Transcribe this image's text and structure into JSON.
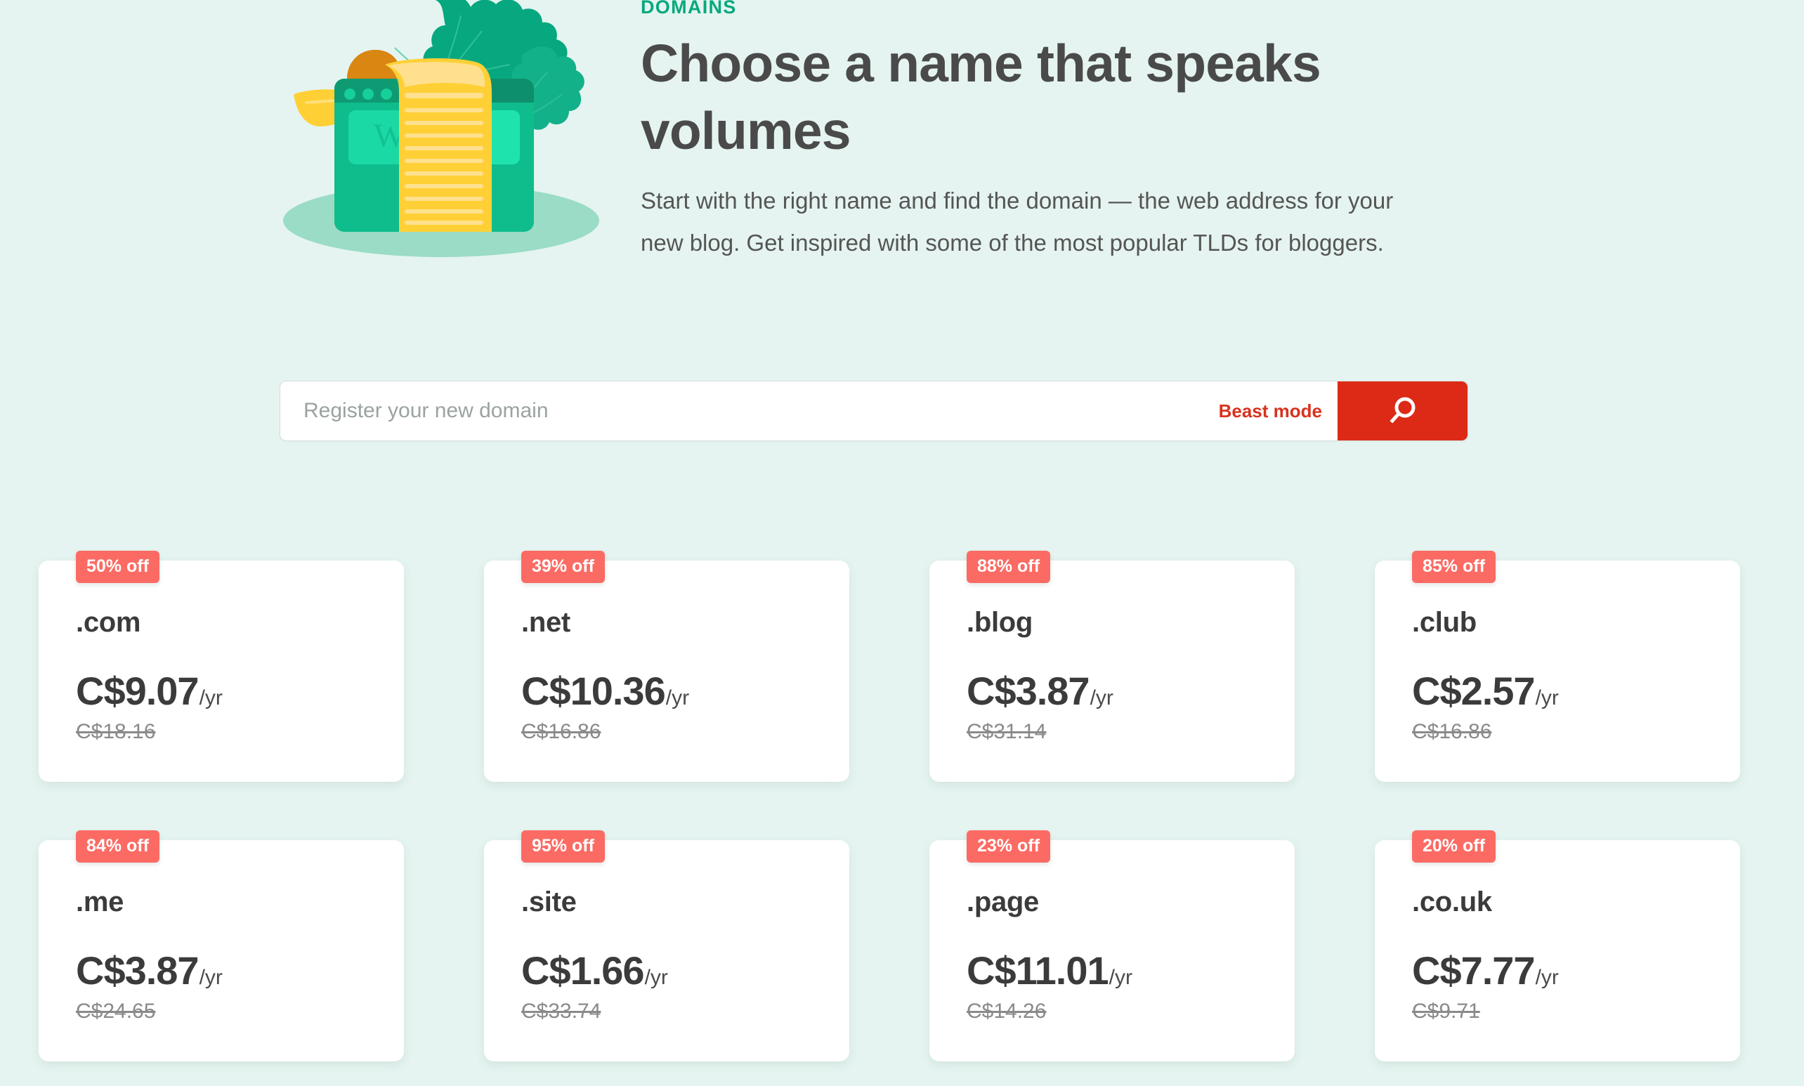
{
  "hero": {
    "eyebrow": "DOMAINS",
    "title": "Choose a name that speaks volumes",
    "description": "Start with the right name and find the domain — the web address for your new blog. Get inspired with some of the most popular TLDs for bloggers.",
    "illustration_name": "blog-window-scroll-leaf-illustration",
    "illustration_logo_letter": "W"
  },
  "search": {
    "placeholder": "Register your new domain",
    "value": "",
    "beast_mode_label": "Beast mode",
    "submit_icon": "search-icon",
    "button_color": "#DC2A16",
    "beast_mode_color": "#D8321E"
  },
  "colors": {
    "background": "#E5F4F0",
    "eyebrow": "#07A87F",
    "badge": "#FB6B64",
    "heading": "#4A4A4A",
    "card": "#FFFFFF",
    "old_price": "#8A8A8A"
  },
  "cards": [
    {
      "tld": ".com",
      "badge": "50% off",
      "price": "C$9.07",
      "per": "/yr",
      "old_price": "C$18.16"
    },
    {
      "tld": ".net",
      "badge": "39% off",
      "price": "C$10.36",
      "per": "/yr",
      "old_price": "C$16.86"
    },
    {
      "tld": ".blog",
      "badge": "88% off",
      "price": "C$3.87",
      "per": "/yr",
      "old_price": "C$31.14"
    },
    {
      "tld": ".club",
      "badge": "85% off",
      "price": "C$2.57",
      "per": "/yr",
      "old_price": "C$16.86"
    },
    {
      "tld": ".me",
      "badge": "84% off",
      "price": "C$3.87",
      "per": "/yr",
      "old_price": "C$24.65"
    },
    {
      "tld": ".site",
      "badge": "95% off",
      "price": "C$1.66",
      "per": "/yr",
      "old_price": "C$33.74"
    },
    {
      "tld": ".page",
      "badge": "23% off",
      "price": "C$11.01",
      "per": "/yr",
      "old_price": "C$14.26"
    },
    {
      "tld": ".co.uk",
      "badge": "20% off",
      "price": "C$7.77",
      "per": "/yr",
      "old_price": "C$9.71"
    }
  ]
}
